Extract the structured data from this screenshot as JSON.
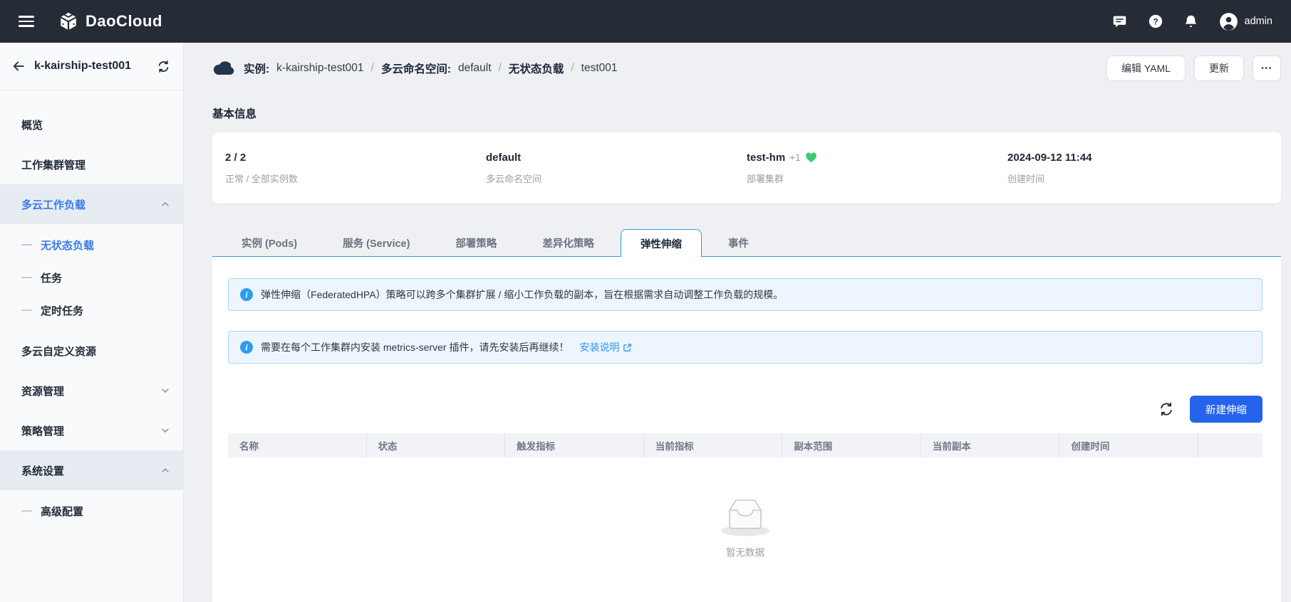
{
  "topbar": {
    "brand": "DaoCloud",
    "user": "admin"
  },
  "sidebar": {
    "cluster": "k-kairship-test001",
    "items": [
      {
        "label": "概览"
      },
      {
        "label": "工作集群管理"
      },
      {
        "label": "多云工作负载"
      },
      {
        "label": "无状态负载"
      },
      {
        "label": "任务"
      },
      {
        "label": "定时任务"
      },
      {
        "label": "多云自定义资源"
      },
      {
        "label": "资源管理"
      },
      {
        "label": "策略管理"
      },
      {
        "label": "系统设置"
      },
      {
        "label": "高级配置"
      }
    ]
  },
  "breadcrumb": {
    "segments": [
      {
        "label": "实例:"
      },
      {
        "label": "k-kairship-test001"
      },
      {
        "label": "/"
      },
      {
        "label": "多云命名空间:"
      },
      {
        "label": "default"
      },
      {
        "label": "/"
      },
      {
        "label": "无状态负载"
      },
      {
        "label": "/"
      },
      {
        "label": "test001"
      }
    ]
  },
  "actions": {
    "edit_yaml": "编辑 YAML",
    "update": "更新",
    "more": "•••"
  },
  "basic_info": {
    "title": "基本信息",
    "stats": [
      {
        "value": "2 / 2",
        "label": "正常 / 全部实例数"
      },
      {
        "value": "default",
        "label": "多云命名空间"
      },
      {
        "value": "test-hm",
        "badge": "+1",
        "label": "部署集群"
      },
      {
        "value": "2024-09-12 11:44",
        "label": "创建时间"
      }
    ]
  },
  "tabs": [
    {
      "label": "实例 (Pods)"
    },
    {
      "label": "服务 (Service)"
    },
    {
      "label": "部署策略"
    },
    {
      "label": "差异化策略"
    },
    {
      "label": "弹性伸缩",
      "active": true
    },
    {
      "label": "事件"
    }
  ],
  "alerts": [
    {
      "text": "弹性伸缩（FederatedHPA）策略可以跨多个集群扩展 / 缩小工作负载的副本，旨在根据需求自动调整工作负载的规模。"
    },
    {
      "text": "需要在每个工作集群内安装 metrics-server 插件，请先安装后再继续！",
      "link": "安装说明"
    }
  ],
  "toolbar": {
    "create_label": "新建伸缩"
  },
  "table": {
    "headers": [
      "名称",
      "状态",
      "触发指标",
      "当前指标",
      "副本范围",
      "当前副本",
      "创建时间",
      ""
    ]
  },
  "empty": {
    "text": "暂无数据"
  },
  "colors": {
    "topbar_bg": "#262c35",
    "tab_accent": "#2e9be0",
    "link_blue": "#3693f2",
    "primary_button": "#2563eb",
    "sidebar_active": "#3a7be8",
    "heart_green": "#3ecb6e",
    "alert_bg": "#edf6fe",
    "alert_border": "#a9d5f3"
  }
}
